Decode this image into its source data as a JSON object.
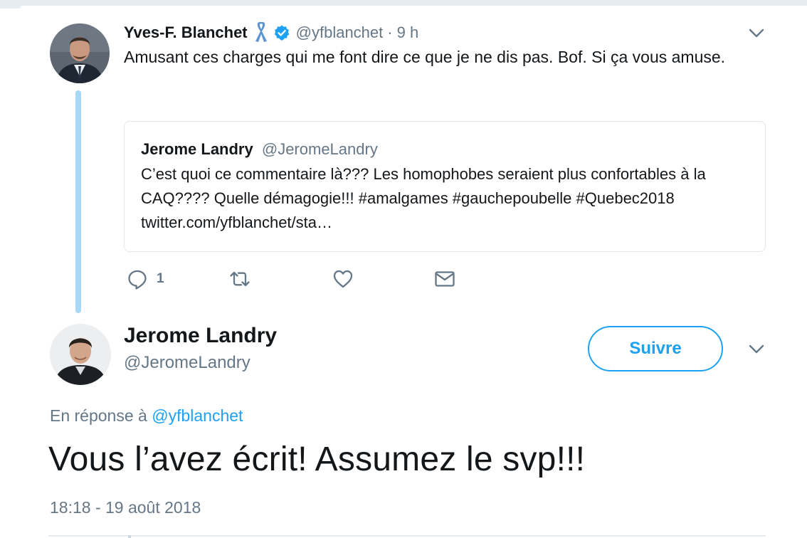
{
  "parent_tweet": {
    "author_name": "Yves-F. Blanchet",
    "handle": "@yfblanchet",
    "separator": "·",
    "time": "9 h",
    "text": "Amusant ces charges qui me font dire ce que je ne dis pas.  Bof.  Si ça vous amuse.",
    "ribbon_icon": "blue-ribbon-icon",
    "verified_icon": "verified-badge-icon",
    "quoted_tweet": {
      "author_name": "Jerome Landry",
      "handle": "@JeromeLandry",
      "text": "C’est quoi ce commentaire là??? Les homophobes seraient plus confortables à la CAQ???? Quelle démagogie!!! #amalgames #gauchepoubelle #Quebec2018 twitter.com/yfblanchet/sta…"
    },
    "actions": {
      "reply_count": "1"
    }
  },
  "main_tweet": {
    "author_name": "Jerome Landry",
    "handle": "@JeromeLandry",
    "follow_label": "Suivre",
    "reply_to_prefix": "En réponse à",
    "reply_to_handle": "@yfblanchet",
    "text": "Vous l’avez écrit! Assumez le svp!!!",
    "timestamp": "18:18 - 19 août 2018"
  },
  "colors": {
    "accent": "#1da1f2",
    "muted": "#657786",
    "text": "#14171a",
    "thread_line": "#a9d7f6",
    "border": "#e1e8ed"
  }
}
